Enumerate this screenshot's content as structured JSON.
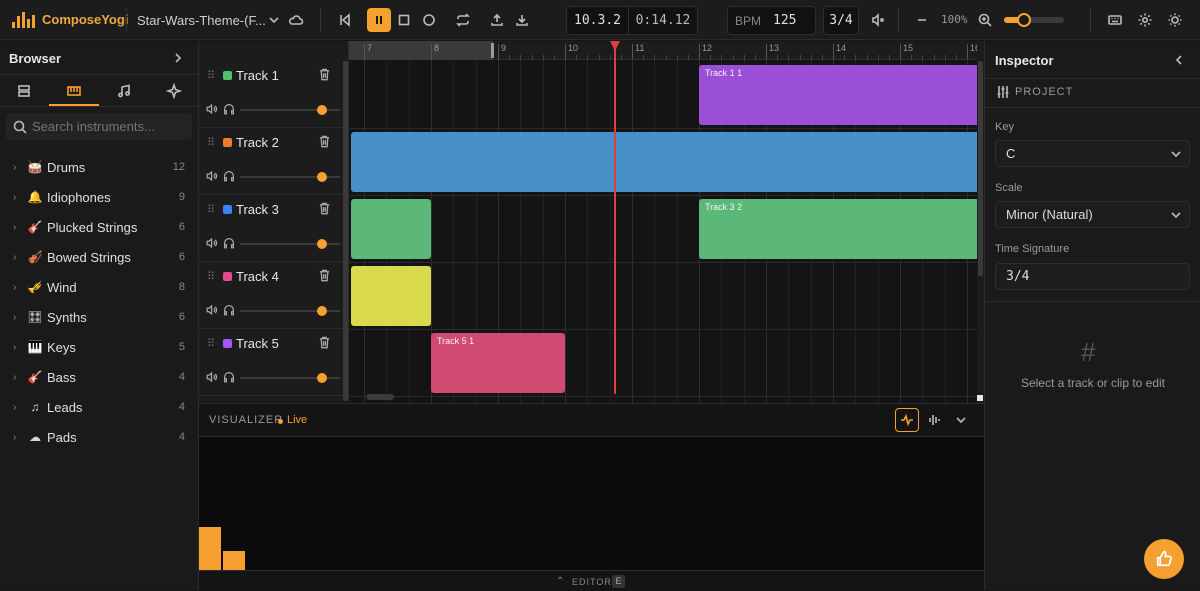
{
  "app": {
    "name": "ComposeYogi",
    "project_title": "Star-Wars-Theme-(F..."
  },
  "transport": {
    "position": "10.3.2",
    "time": "0:14.12",
    "bpm_label": "BPM",
    "bpm": "125",
    "time_signature": "3/4",
    "zoom": "100%",
    "zoom_level": 0.2
  },
  "colors": {
    "accent": "#f5a030",
    "playhead": "#e0403c"
  },
  "browser": {
    "title": "Browser",
    "search_placeholder": "Search instruments...",
    "tabs": [
      {
        "icon": "layout-icon"
      },
      {
        "icon": "piano-icon"
      },
      {
        "icon": "music-note-icon"
      },
      {
        "icon": "sparkle-icon"
      }
    ],
    "categories": [
      {
        "label": "Drums",
        "count": "12",
        "icon": "drum-icon"
      },
      {
        "label": "Idiophones",
        "count": "9",
        "icon": "bell-icon"
      },
      {
        "label": "Plucked Strings",
        "count": "6",
        "icon": "guitar-icon"
      },
      {
        "label": "Bowed Strings",
        "count": "6",
        "icon": "violin-icon"
      },
      {
        "label": "Wind",
        "count": "8",
        "icon": "horn-icon"
      },
      {
        "label": "Synths",
        "count": "6",
        "icon": "sliders-icon"
      },
      {
        "label": "Keys",
        "count": "5",
        "icon": "keyboard-icon"
      },
      {
        "label": "Bass",
        "count": "4",
        "icon": "bass-guitar-icon"
      },
      {
        "label": "Leads",
        "count": "4",
        "icon": "music-note-icon"
      },
      {
        "label": "Pads",
        "count": "4",
        "icon": "cloud-icon"
      }
    ]
  },
  "tracks": [
    {
      "name": "Track 1",
      "color": "#4fc16a",
      "volume": 1.0
    },
    {
      "name": "Track 2",
      "color": "#f07a30",
      "volume": 1.0
    },
    {
      "name": "Track 3",
      "color": "#3b82f6",
      "volume": 1.0
    },
    {
      "name": "Track 4",
      "color": "#e54b8a",
      "volume": 1.0
    },
    {
      "name": "Track 5",
      "color": "#a855f7",
      "volume": 1.0
    }
  ],
  "ruler": {
    "bars": [
      "7",
      "8",
      "9",
      "10",
      "11",
      "12",
      "13",
      "14",
      "15",
      "16"
    ]
  },
  "clips": [
    {
      "label": "Track 1 1",
      "track": 0,
      "start_bar": 12.0,
      "end_bar": 17.0,
      "color": "#9b4fd6"
    },
    {
      "label": "",
      "track": 1,
      "start_bar": 6.8,
      "end_bar": 17.0,
      "color": "#4a90c8"
    },
    {
      "label": "",
      "track": 2,
      "start_bar": 6.8,
      "end_bar": 8.0,
      "color": "#5bb878"
    },
    {
      "label": "Track 3 2",
      "track": 2,
      "start_bar": 12.0,
      "end_bar": 17.0,
      "color": "#5bb878"
    },
    {
      "label": "",
      "track": 3,
      "start_bar": 6.8,
      "end_bar": 8.0,
      "color": "#d9d94e"
    },
    {
      "label": "Track 5 1",
      "track": 4,
      "start_bar": 8.0,
      "end_bar": 10.0,
      "color": "#d04a72"
    }
  ],
  "playhead_bar": 10.75,
  "visualizer": {
    "title": "VISUALIZER",
    "status": "Live",
    "bars": [
      0.2,
      0.09
    ]
  },
  "footer": {
    "label": "EDITOR",
    "shortcut": "E"
  },
  "inspector": {
    "title": "Inspector",
    "section": "PROJECT",
    "key_label": "Key",
    "key_value": "C",
    "scale_label": "Scale",
    "scale_value": "Minor (Natural)",
    "ts_label": "Time Signature",
    "ts_value": "3/4",
    "empty_text": "Select a track or clip to edit"
  }
}
